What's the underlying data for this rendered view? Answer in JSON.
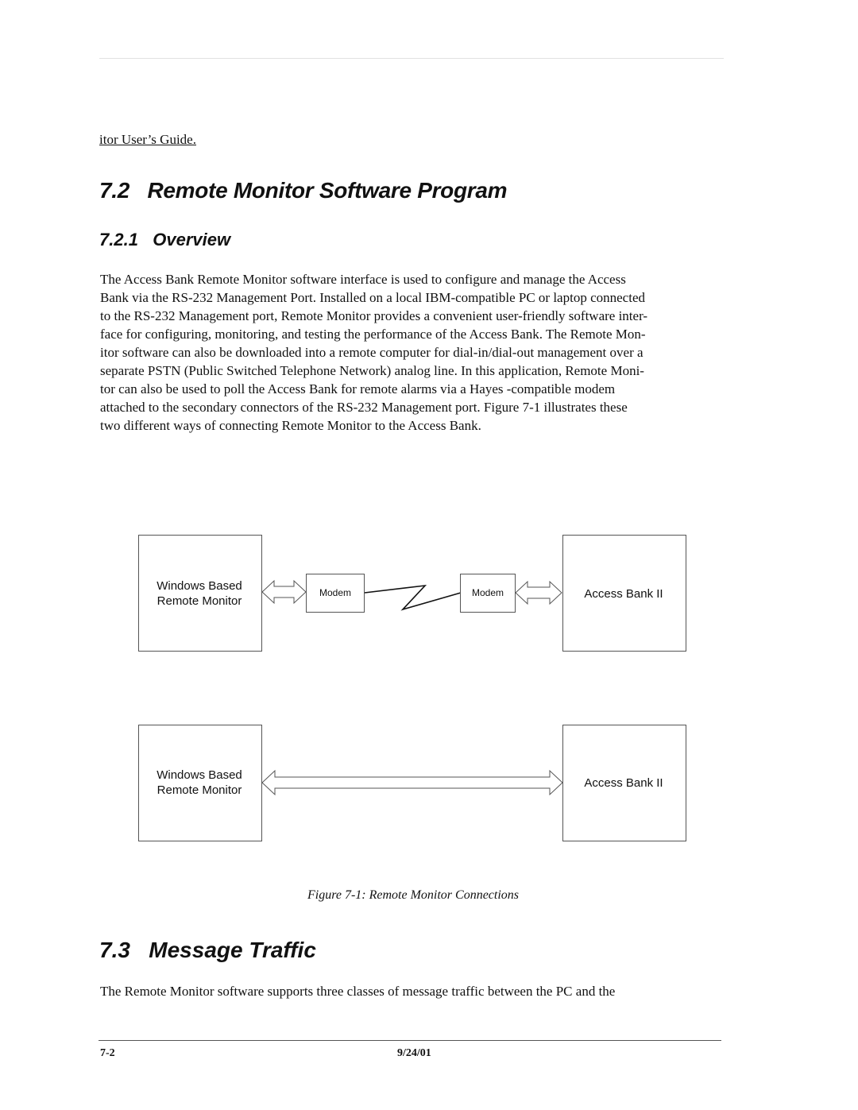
{
  "header": {
    "running_head": "itor User’s Guide."
  },
  "section_7_2": {
    "number": "7.2",
    "title": "Remote Monitor Software Program"
  },
  "section_7_2_1": {
    "number": "7.2.1",
    "title": "Overview",
    "paragraph_lines": [
      "The Access Bank Remote Monitor software interface is used to configure and manage the Access",
      "Bank via the RS-232 Management Port. Installed on a local IBM-compatible PC or laptop connected",
      "to the RS-232 Management port, Remote Monitor provides a convenient user-friendly software inter-",
      "face for configuring, monitoring, and testing the performance of the Access Bank. The Remote Mon-",
      "itor software can also be downloaded into a remote computer for dial-in/dial-out management over a",
      "separate PSTN (Public Switched Telephone Network) analog line. In this application, Remote Moni-",
      "tor can also be used to poll the Access Bank for remote alarms via a Hayes   -compatible modem",
      "attached to the secondary connectors of the RS-232 Management port. Figure 7-1 illustrates these",
      "two different ways of connecting Remote Monitor to the Access Bank."
    ]
  },
  "figure": {
    "dialup": {
      "pc_label_line1": "Windows Based",
      "pc_label_line2": "Remote Monitor",
      "modem_left_label": "Modem",
      "modem_right_label": "Modem",
      "bank_label": "Access Bank II"
    },
    "direct": {
      "pc_label_line1": "Windows Based",
      "pc_label_line2": "Remote Monitor",
      "bank_label": "Access Bank II"
    },
    "caption": "Figure 7-1: Remote Monitor Connections"
  },
  "section_7_3": {
    "number": "7.3",
    "title": "Message Traffic",
    "paragraph_lines": [
      "The Remote Monitor software supports three classes of message traffic between the PC and the"
    ]
  },
  "footer": {
    "page_number": "7-2",
    "date": "9/24/01"
  }
}
